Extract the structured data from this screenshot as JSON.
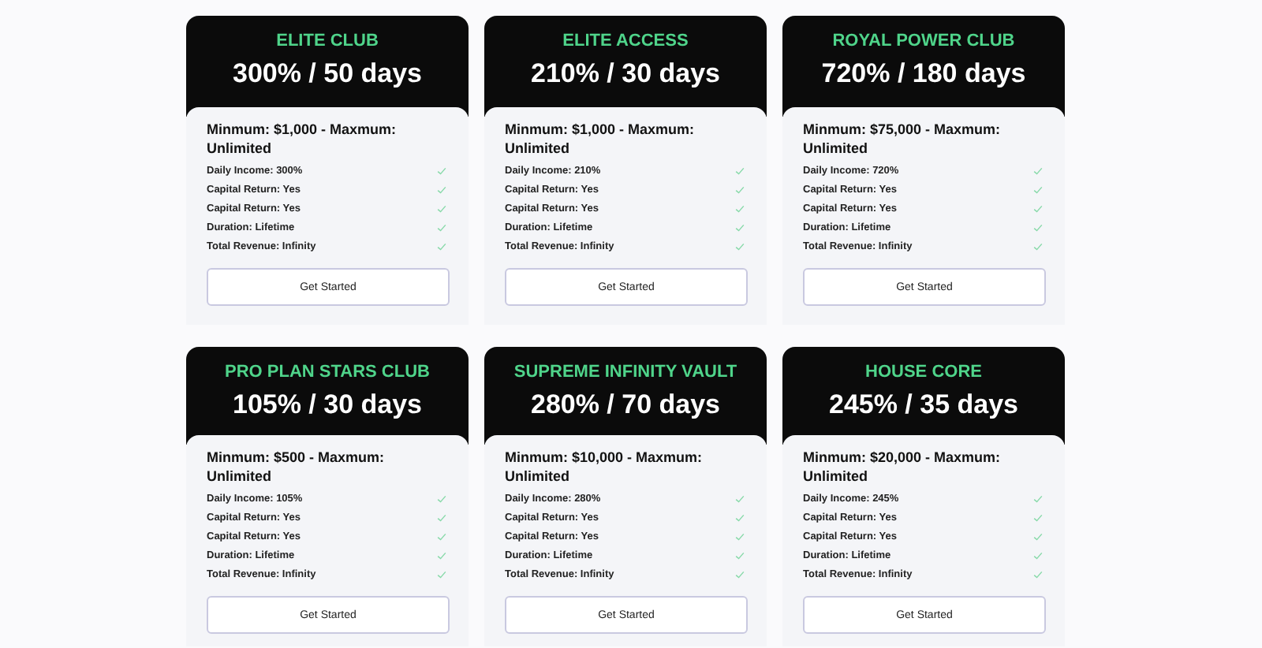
{
  "plans": [
    {
      "name": "ELITE CLUB",
      "rate": "300% / 50 days",
      "limits": "Minmum: $1,000 - Maxmum: Unlimited",
      "features": [
        "Daily Income: 300%",
        "Capital Return: Yes",
        "Capital Return: Yes",
        "Duration: Lifetime",
        "Total Revenue: Infinity"
      ],
      "button": "Get Started"
    },
    {
      "name": "ELITE ACCESS",
      "rate": "210% / 30 days",
      "limits": "Minmum: $1,000 - Maxmum: Unlimited",
      "features": [
        "Daily Income: 210%",
        "Capital Return: Yes",
        "Capital Return: Yes",
        "Duration: Lifetime",
        "Total Revenue: Infinity"
      ],
      "button": "Get Started"
    },
    {
      "name": "ROYAL POWER CLUB",
      "rate": "720% / 180 days",
      "limits": "Minmum: $75,000 - Maxmum: Unlimited",
      "features": [
        "Daily Income: 720%",
        "Capital Return: Yes",
        "Capital Return: Yes",
        "Duration: Lifetime",
        "Total Revenue: Infinity"
      ],
      "button": "Get Started"
    },
    {
      "name": "PRO PLAN STARS CLUB",
      "rate": "105% / 30 days",
      "limits": "Minmum: $500 - Maxmum: Unlimited",
      "features": [
        "Daily Income: 105%",
        "Capital Return: Yes",
        "Capital Return: Yes",
        "Duration: Lifetime",
        "Total Revenue: Infinity"
      ],
      "button": "Get Started"
    },
    {
      "name": "SUPREME INFINITY VAULT",
      "rate": "280% / 70 days",
      "limits": "Minmum: $10,000 - Maxmum: Unlimited",
      "features": [
        "Daily Income: 280%",
        "Capital Return: Yes",
        "Capital Return: Yes",
        "Duration: Lifetime",
        "Total Revenue: Infinity"
      ],
      "button": "Get Started"
    },
    {
      "name": "HOUSE CORE",
      "rate": "245% / 35 days",
      "limits": "Minmum: $20,000 - Maxmum: Unlimited",
      "features": [
        "Daily Income: 245%",
        "Capital Return: Yes",
        "Capital Return: Yes",
        "Duration: Lifetime",
        "Total Revenue: Infinity"
      ],
      "button": "Get Started"
    }
  ]
}
